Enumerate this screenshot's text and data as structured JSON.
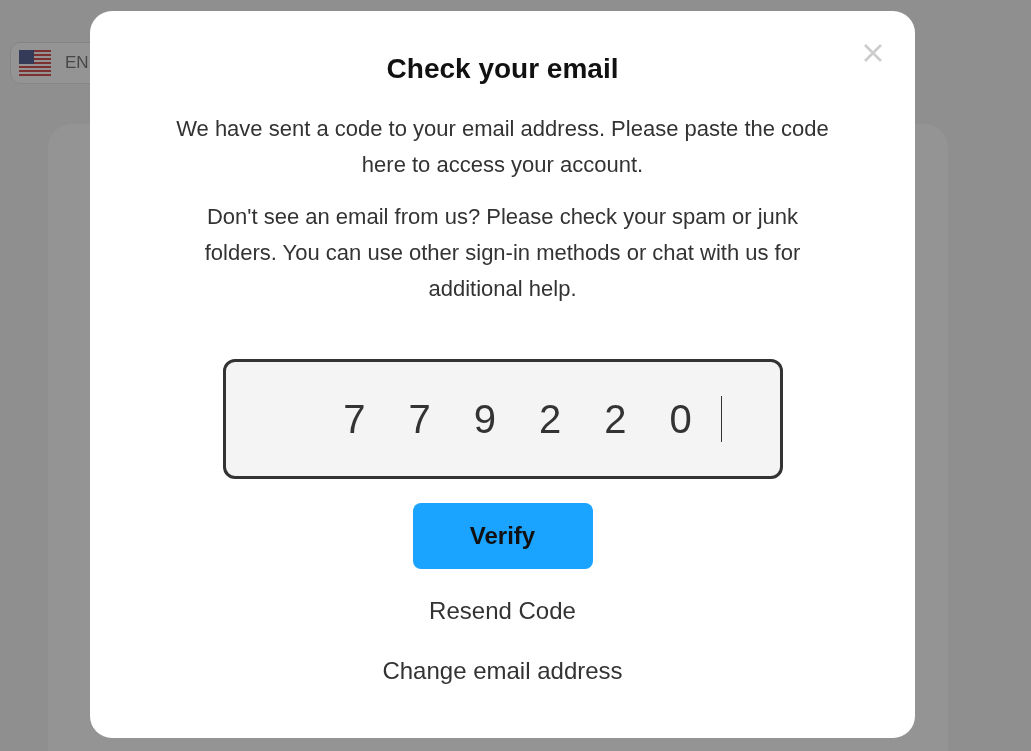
{
  "language_button": {
    "label": "EN"
  },
  "dialog": {
    "title": "Check your email",
    "paragraphs": [
      "We have sent a code to your email address. Please paste the code here to access your account.",
      "Don't see an email from us? Please check your spam or junk folders. You can use other sign-in methods or chat with us for additional help."
    ],
    "code_field": {
      "value": "779220"
    },
    "verify_button": {
      "label": "Verify"
    },
    "links": [
      "Resend Code",
      "Change email address"
    ]
  }
}
